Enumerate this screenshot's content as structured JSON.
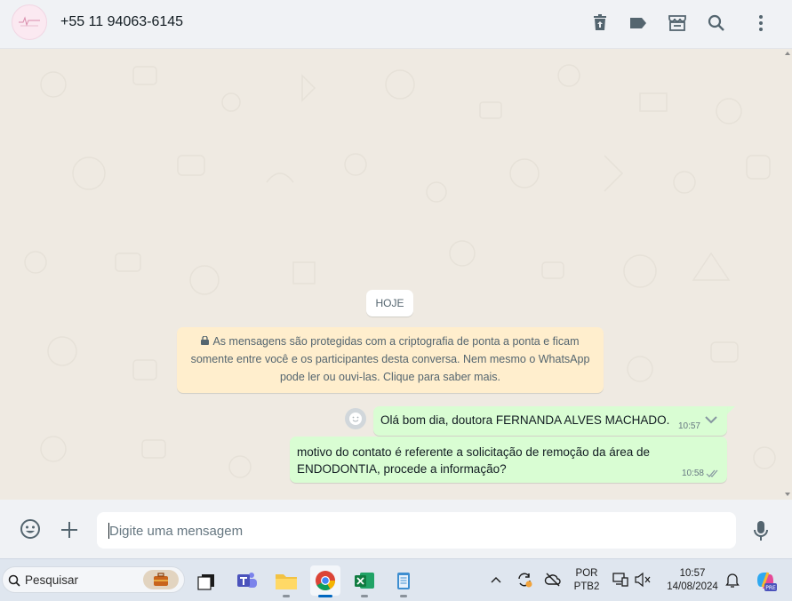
{
  "header": {
    "contact_name": "+55 11 94063-6145"
  },
  "chat": {
    "date_label": "HOJE",
    "encryption_line1": "As mensagens são protegidas com a criptografia de ponta a ponta e ficam",
    "encryption_line2": "somente entre você e os participantes desta conversa. Nem mesmo o WhatsApp",
    "encryption_line3": "pode ler ou ouvi-las. Clique para saber mais.",
    "messages": [
      {
        "text": "Olá bom dia, doutora FERNANDA ALVES MACHADO.",
        "time": "10:57"
      },
      {
        "text_line1": "motivo do contato é referente a solicitação de remoção da área de",
        "text_line2": "ENDODONTIA, procede a informação?",
        "time": "10:58"
      }
    ]
  },
  "composer": {
    "placeholder": "Digite uma mensagem"
  },
  "taskbar": {
    "search_label": "Pesquisar",
    "lang_line1": "POR",
    "lang_line2": "PTB2",
    "time": "10:57",
    "date": "14/08/2024",
    "copilot_badge": "PRE"
  },
  "colors": {
    "accent": "#00a884",
    "outgoing_bubble": "#d9fdd3",
    "chat_bg": "#efeae2",
    "encryption_bg": "#ffeecd"
  }
}
